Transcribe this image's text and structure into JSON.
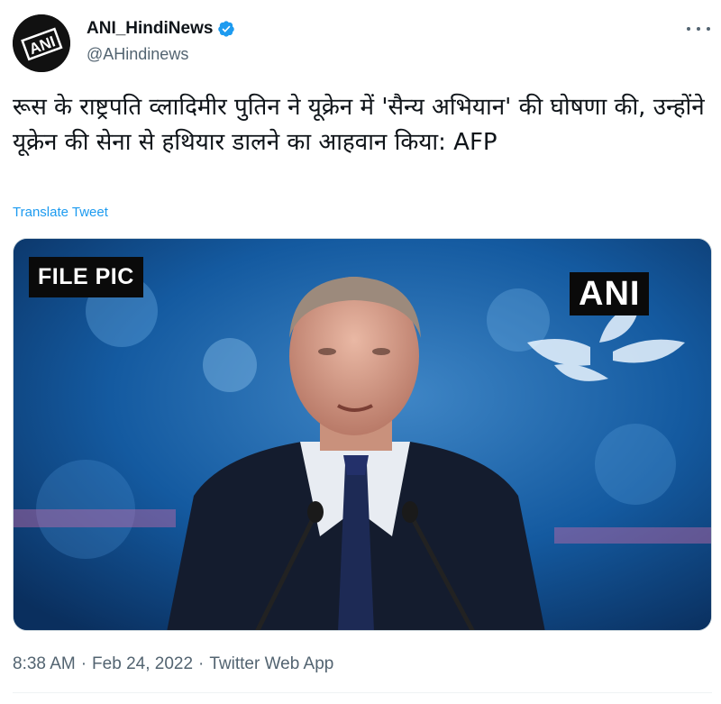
{
  "author": {
    "display_name": "ANI_HindiNews",
    "handle": "@AHindinews",
    "avatar_text": "ANI",
    "verified": true
  },
  "tweet": {
    "text": "रूस के राष्ट्रपति व्लादिमीर पुतिन ने यूक्रेन में 'सैन्य अभियान' की घोषणा की, उन्होंने यूक्रेन की सेना से हथियार डालने का आहवान किया: AFP",
    "translate_label": "Translate Tweet"
  },
  "media": {
    "file_pic_label": "FILE PIC",
    "watermark": "ANI"
  },
  "meta": {
    "time": "8:38 AM",
    "separator": "·",
    "date": "Feb 24, 2022",
    "source": "Twitter Web App"
  },
  "colors": {
    "link": "#1d9bf0",
    "verified": "#1d9bf0",
    "secondary_text": "#536471"
  }
}
